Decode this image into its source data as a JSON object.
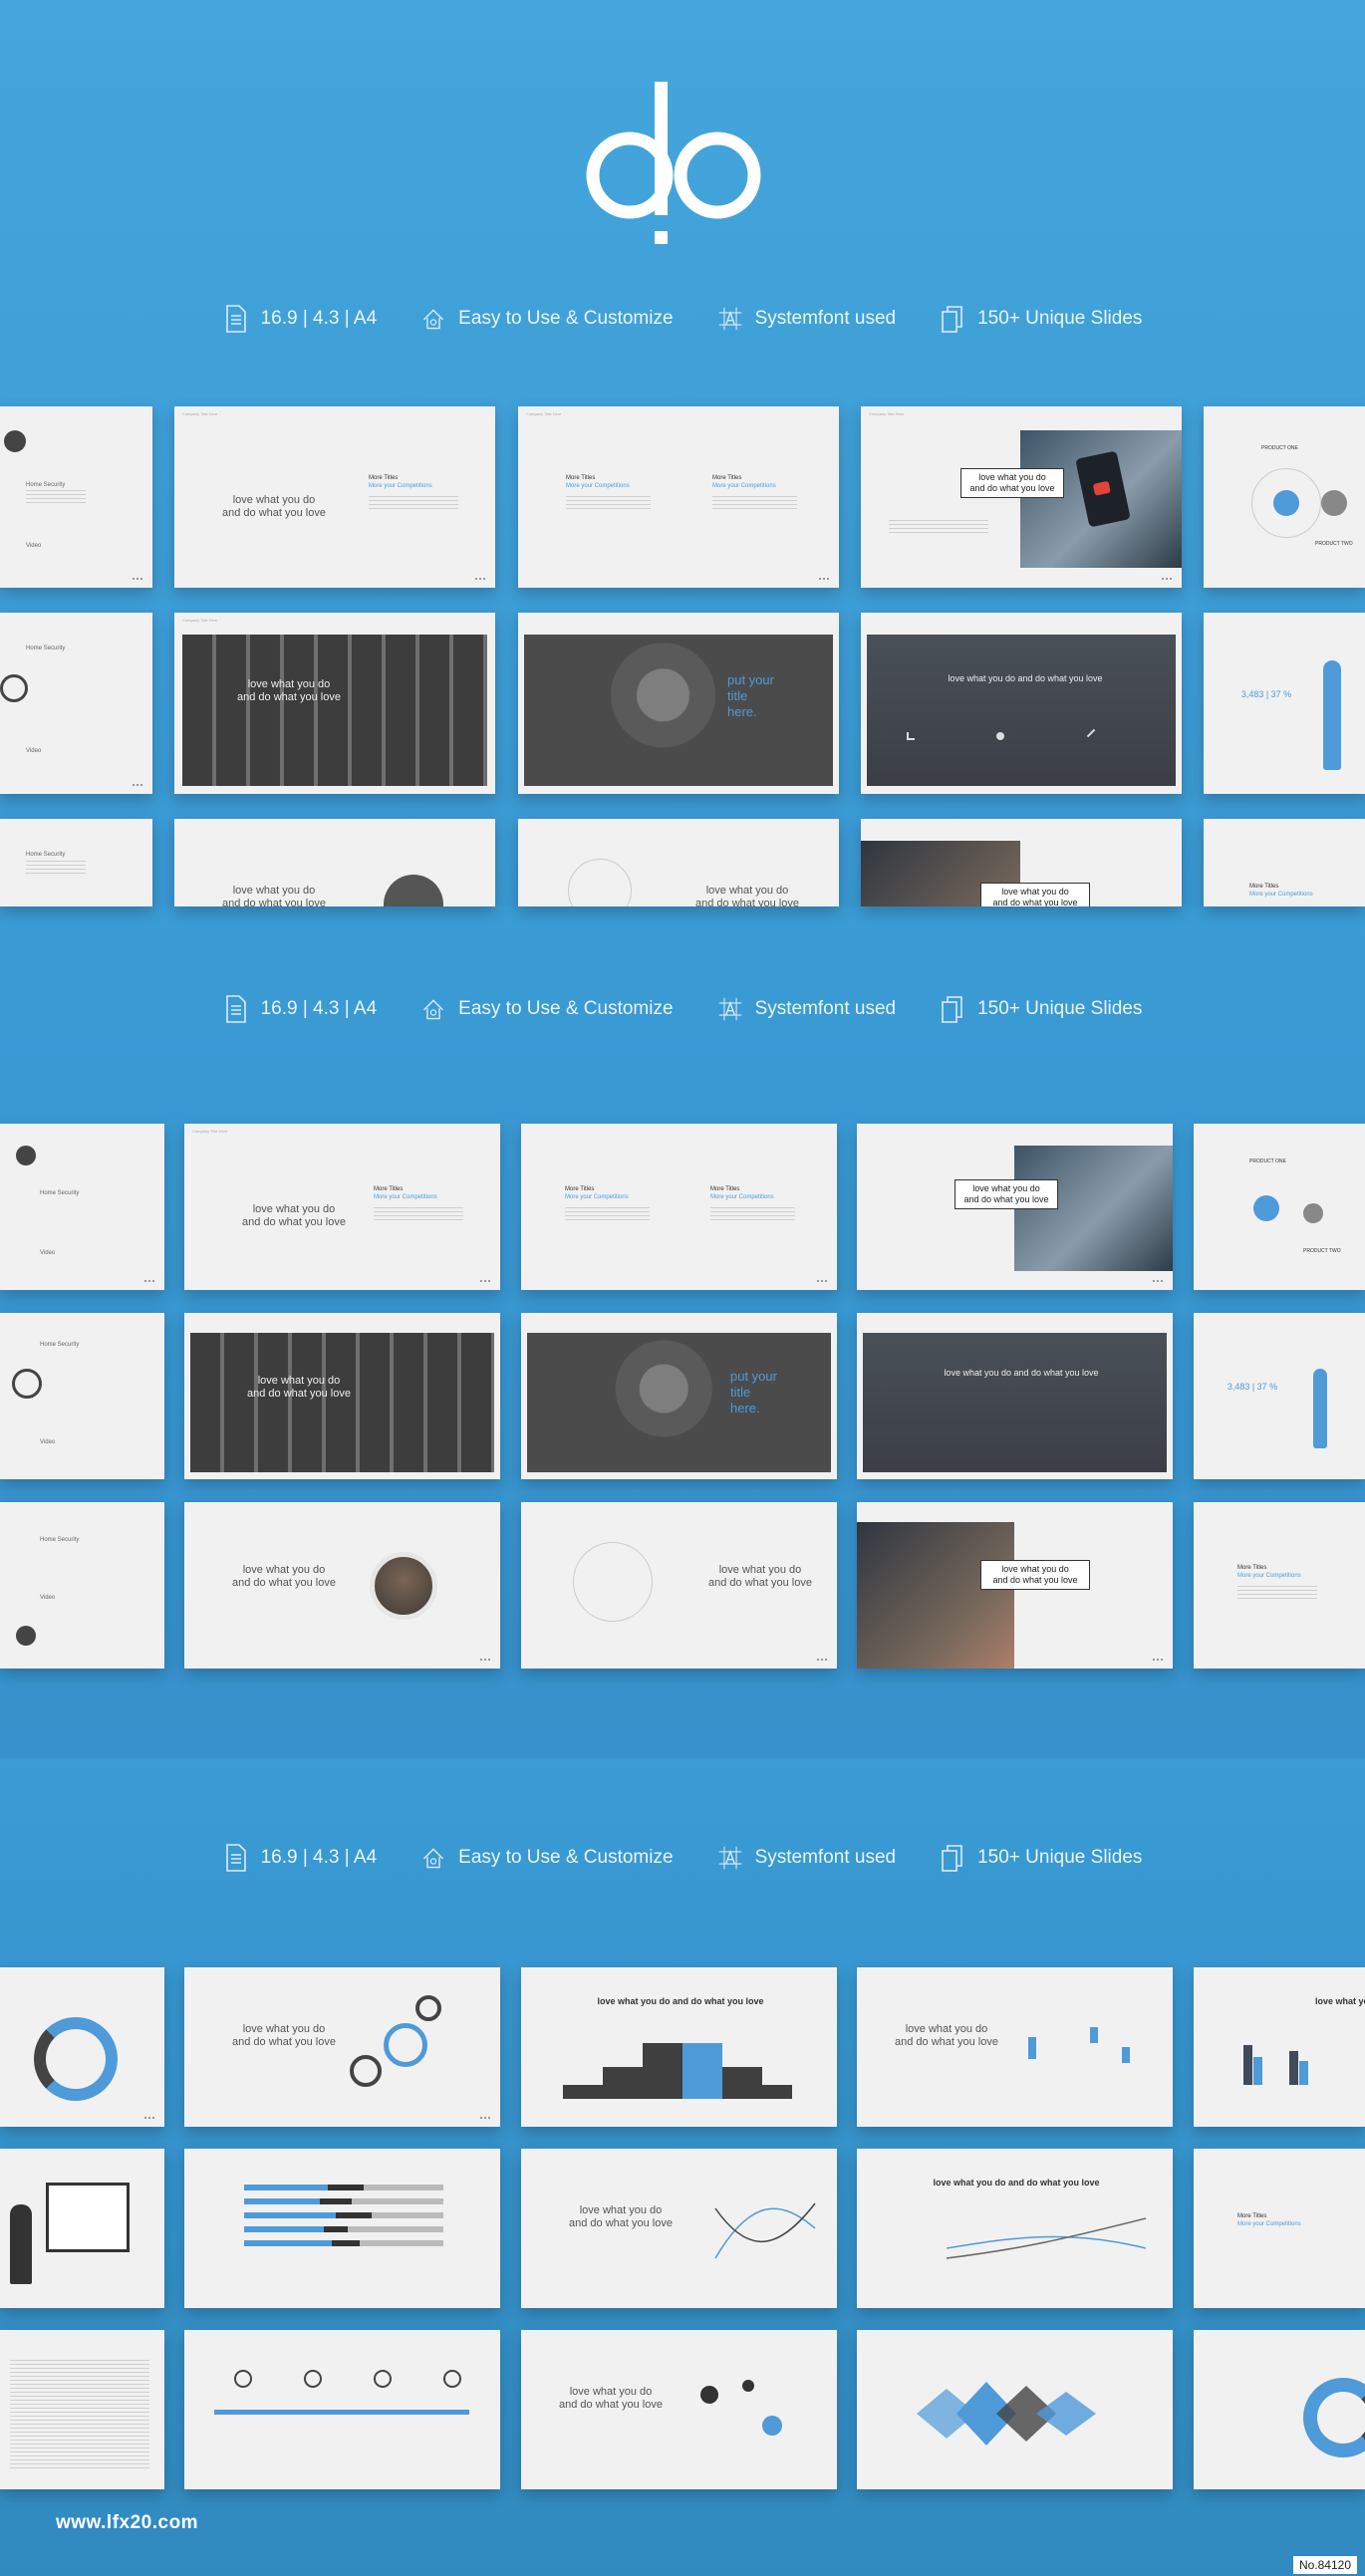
{
  "brand": {
    "logo_text": "do",
    "accent": "#4f9ad9",
    "background": "#3b9ed6"
  },
  "features": [
    {
      "icon": "document-icon",
      "label": "16.9  |  4.3  |  A4"
    },
    {
      "icon": "house-tools-icon",
      "label": "Easy to Use & Customize"
    },
    {
      "icon": "font-grid-icon",
      "label": "Systemfont used"
    },
    {
      "icon": "slides-stack-icon",
      "label": "150+ Unique Slides"
    }
  ],
  "slide_text": {
    "header": "Company Title Here",
    "love_two_line_a": "love what you do",
    "love_two_line_b": "and do what you love",
    "love_one_line": "love what you do and do what you love",
    "more_titles": "More Titles",
    "more_titles_sub": "More your Competitions",
    "put_title": "put your title here.",
    "stat": "3,483  |  37 %",
    "product_one": "PRODUCT ONE",
    "product_two": "PRODUCT TWO",
    "menu_home": "Home Security",
    "menu_video": "Video"
  },
  "footer": {
    "url": "www.lfx20.com",
    "id": "No.84120"
  }
}
